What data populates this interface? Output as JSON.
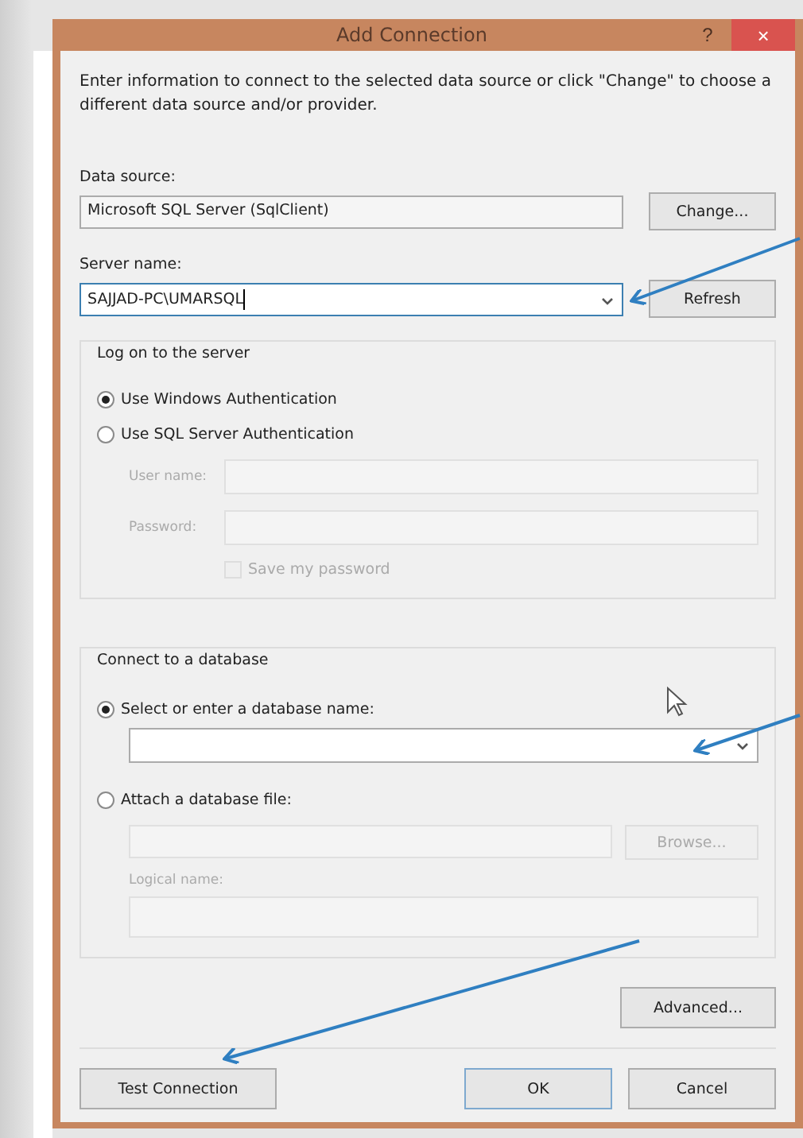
{
  "window": {
    "title": "Add Connection",
    "help": "?",
    "close": "×"
  },
  "intro": "Enter information to connect to the selected data source or click \"Change\" to choose a different data source and/or provider.",
  "data_source": {
    "label": "Data source:",
    "value": "Microsoft SQL Server (SqlClient)",
    "button": "Change..."
  },
  "server_name": {
    "label": "Server name:",
    "value": "SAJJAD-PC\\UMARSQL",
    "button": "Refresh"
  },
  "log_on": {
    "title": "Log on to the server",
    "options": [
      {
        "label": "Use Windows Authentication",
        "selected": true
      },
      {
        "label": "Use SQL Server Authentication",
        "selected": false
      }
    ],
    "credentials": {
      "disabled": true,
      "user_name": "User name:",
      "password": "Password:",
      "save_password": {
        "label": "Save my password",
        "checked": false
      }
    }
  },
  "database": {
    "title": "Connect to a database",
    "options": [
      {
        "label": "Select or enter a database name:",
        "selected": true
      },
      {
        "label": "Attach a database file:",
        "selected": false
      }
    ],
    "file": {
      "disabled": true,
      "button": "Browse...",
      "logical_name": "Logical name:"
    }
  },
  "buttons": {
    "advanced": "Advanced...",
    "test": "Test Connection",
    "ok": "OK",
    "cancel": "Cancel"
  }
}
